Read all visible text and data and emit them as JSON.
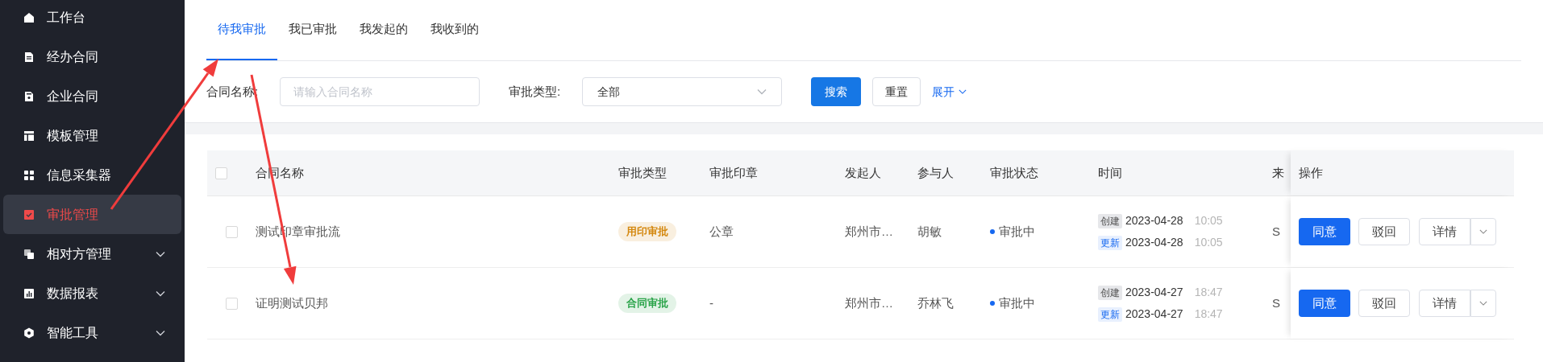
{
  "sidebar": {
    "items": [
      {
        "label": "工作台",
        "selected": false
      },
      {
        "label": "经办合同",
        "selected": false
      },
      {
        "label": "企业合同",
        "selected": false
      },
      {
        "label": "模板管理",
        "selected": false
      },
      {
        "label": "信息采集器",
        "selected": false
      },
      {
        "label": "审批管理",
        "selected": true
      },
      {
        "label": "相对方管理",
        "selected": false,
        "expanded": false
      },
      {
        "label": "数据报表",
        "selected": false,
        "expanded": false
      },
      {
        "label": "智能工具",
        "selected": false,
        "expanded": false
      }
    ]
  },
  "tabs": [
    {
      "label": "待我审批",
      "selected": true
    },
    {
      "label": "我已审批",
      "selected": false
    },
    {
      "label": "我发起的",
      "selected": false
    },
    {
      "label": "我收到的",
      "selected": false
    }
  ],
  "filters": [
    {
      "kind": "text",
      "label": "合同名称:",
      "placeholder": "请输入合同名称"
    },
    {
      "kind": "select",
      "label": "审批类型:",
      "value": "全部"
    }
  ],
  "filter_buttons": {
    "search": "搜索",
    "reset": "重置",
    "expand": "展开"
  },
  "table": {
    "select_all_checked": false,
    "columns": [
      "合同名称",
      "审批类型",
      "审批印章",
      "发起人",
      "参与人",
      "审批状态",
      "时间",
      "来",
      "操作"
    ],
    "rows": [
      {
        "checked": false,
        "name": "测试印章审批流",
        "type": {
          "label": "用印审批",
          "color": "#d4880f"
        },
        "seal": "公章",
        "initiator": "郑州市…",
        "participant": "胡敏",
        "status": {
          "label": "审批中",
          "color": "#1668f0"
        },
        "created": {
          "tag": "创建",
          "date": "2023-04-28",
          "time": "10:05"
        },
        "updated": {
          "tag": "更新",
          "date": "2023-04-28",
          "time": "10:05"
        },
        "column_8": "S",
        "actions": [
          "同意",
          "驳回",
          "详情"
        ]
      },
      {
        "checked": false,
        "name": "证明测试贝邦",
        "type": {
          "label": "合同审批",
          "color": "#2ba44a"
        },
        "seal": "-",
        "initiator": "郑州市…",
        "participant": "乔林飞",
        "status": {
          "label": "审批中",
          "color": "#1668f0"
        },
        "created": {
          "tag": "创建",
          "date": "2023-04-27",
          "time": "18:47"
        },
        "updated": {
          "tag": "更新",
          "date": "2023-04-27",
          "time": "18:47"
        },
        "column_8": "S",
        "actions": [
          "同意",
          "驳回",
          "详情"
        ]
      }
    ]
  }
}
